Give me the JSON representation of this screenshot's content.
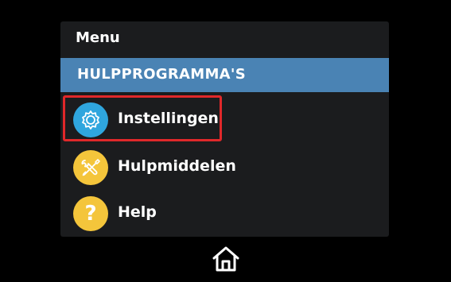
{
  "menu": {
    "title": "Menu",
    "section": "HULPPROGRAMMA'S"
  },
  "items": [
    {
      "label": "Instellingen",
      "icon": "gear-icon",
      "icon_color": "#2fa6de"
    },
    {
      "label": "Hulpmiddelen",
      "icon": "tools-icon",
      "icon_color": "#f4c53b"
    },
    {
      "label": "Help",
      "icon": "question-icon",
      "icon_color": "#f4c53b",
      "icon_text": "?"
    }
  ],
  "footer": {
    "home_icon": "home-icon"
  },
  "colors": {
    "background": "#000000",
    "panel": "#1b1c1e",
    "section_bar": "#4a83b4",
    "highlight": "#e0282a"
  }
}
